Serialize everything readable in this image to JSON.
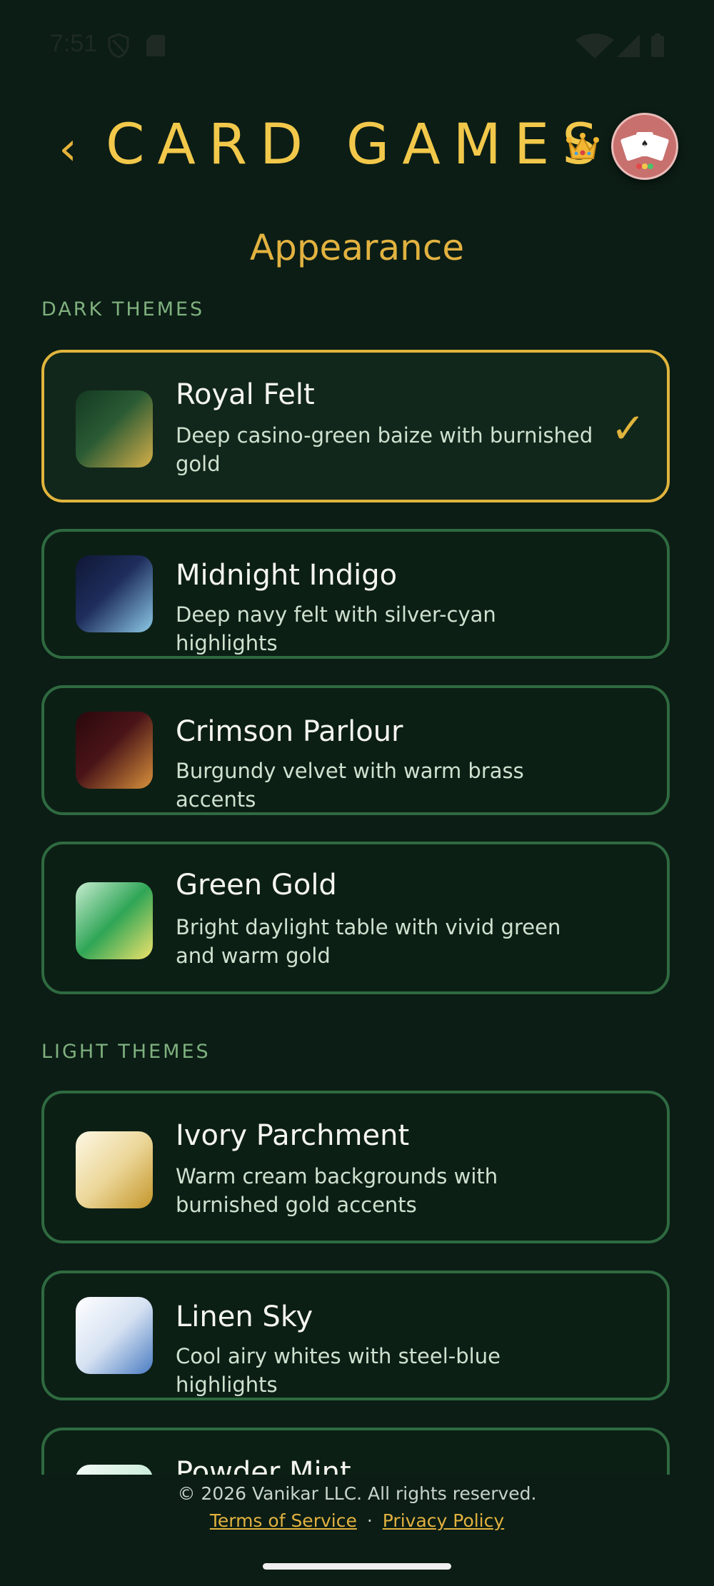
{
  "status_bar": {
    "time": "7:51",
    "icons": [
      "shield-icon",
      "sd-card-icon",
      "wifi-icon",
      "signal-icon",
      "battery-icon"
    ]
  },
  "header": {
    "back_icon": "‹",
    "title": "CARD GAMES",
    "crown_icon": "crown-icon",
    "avatar": "playing-cards-avatar"
  },
  "page": {
    "title": "Appearance"
  },
  "sections": {
    "dark_label": "DARK THEMES",
    "light_label": "LIGHT THEMES"
  },
  "themes": [
    {
      "name": "Royal Felt",
      "description": "Deep casino-green baize with burnished gold",
      "selected": true,
      "colors": [
        "#1e4a2c",
        "#d6b04a"
      ]
    },
    {
      "name": "Midnight Indigo",
      "description": "Deep navy felt with silver-cyan highlights",
      "selected": false,
      "colors": [
        "#141d3c",
        "#7fc0e0"
      ]
    },
    {
      "name": "Crimson Parlour",
      "description": "Burgundy velvet with warm brass accents",
      "selected": false,
      "colors": [
        "#3a0e12",
        "#d08a3c"
      ]
    },
    {
      "name": "Green Gold",
      "description": "Bright daylight table with vivid green and warm gold",
      "selected": false,
      "colors": [
        "#b7e1bf",
        "#1f9a4a",
        "#f0e06c"
      ]
    },
    {
      "name": "Ivory Parchment",
      "description": "Warm cream backgrounds with burnished gold accents",
      "selected": false,
      "colors": [
        "#fbf5dc",
        "#c89a2c"
      ]
    },
    {
      "name": "Linen Sky",
      "description": "Cool airy whites with steel-blue highlights",
      "selected": false,
      "colors": [
        "#f7f9fc",
        "#4d7cc0"
      ]
    },
    {
      "name": "Powder Mint",
      "description": "",
      "selected": false,
      "colors": [
        "#e9f6ee",
        "#9fd6b6"
      ]
    }
  ],
  "selected_check": "✓",
  "footer": {
    "copyright": "© 2026 Vanikar LLC. All rights reserved.",
    "terms": "Terms of Service",
    "separator": "·",
    "privacy": "Privacy Policy"
  }
}
